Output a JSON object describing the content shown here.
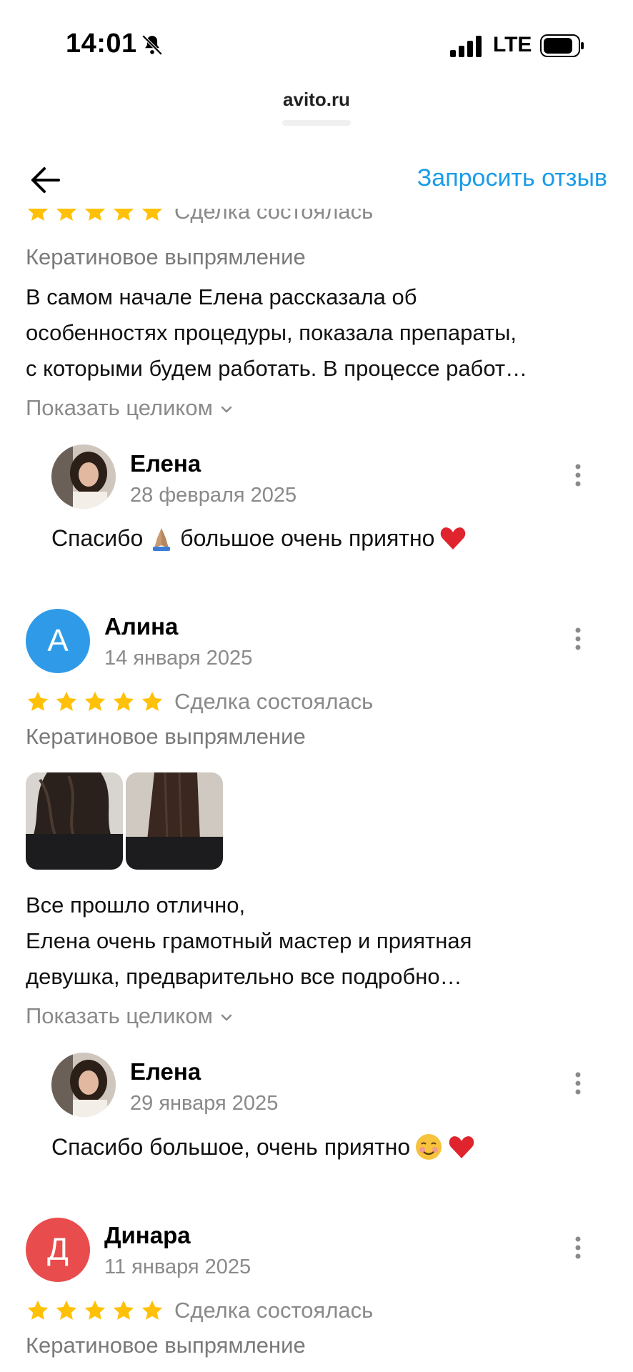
{
  "status_bar": {
    "time": "14:01",
    "network": "LTE"
  },
  "browser": {
    "url": "avito.ru"
  },
  "nav": {
    "request_review_label": "Запросить отзыв"
  },
  "reviews": [
    {
      "deal_status": "Сделка состоялась",
      "service": "Кератиновое выпрямление",
      "text_lines": [
        "В самом начале Елена рассказала об",
        "особенностях процедуры, показала препараты,",
        "с которыми будем работать. В процессе работ…"
      ],
      "show_full_label": "Показать целиком",
      "reply": {
        "name": "Елена",
        "date": "28 февраля 2025",
        "text_before": "Спасибо",
        "text_after": "большое очень приятно"
      }
    },
    {
      "author_initial": "А",
      "author": "Алина",
      "date": "14 января 2025",
      "rating": 5,
      "deal_status": "Сделка состоялась",
      "service": "Кератиновое выпрямление",
      "text_lines": [
        "Все прошло отлично,",
        "Елена очень грамотный мастер и приятная",
        "девушка, предварительно все подробно…"
      ],
      "show_full_label": "Показать целиком",
      "reply": {
        "name": "Елена",
        "date": "29 января 2025",
        "text": "Спасибо большое, очень приятно"
      }
    },
    {
      "author_initial": "Д",
      "author": "Динара",
      "date": "11 января 2025",
      "rating": 5,
      "deal_status": "Сделка состоялась",
      "service": "Кератиновое выпрямление"
    }
  ],
  "colors": {
    "accent": "#1a9ce8",
    "star": "#ffc107",
    "avatar_blue": "#2f9be8",
    "avatar_red": "#e84c4c"
  }
}
